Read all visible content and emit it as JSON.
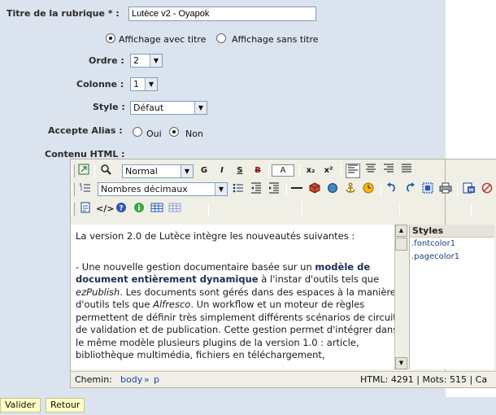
{
  "form": {
    "title_label": "Titre de la rubrique * :",
    "title_value": "Lutèce v2 - Oyapok",
    "display": {
      "with_title": "Affichage avec titre",
      "without_title": "Affichage sans titre",
      "selected": "with_title"
    },
    "order": {
      "label": "Ordre :",
      "value": "2"
    },
    "column": {
      "label": "Colonne :",
      "value": "1"
    },
    "style": {
      "label": "Style :",
      "value": "Défaut"
    },
    "alias": {
      "label": "Accepte Alias :",
      "yes": "Oui",
      "no": "Non",
      "selected": "no"
    },
    "html_label": "Contenu HTML :"
  },
  "editor": {
    "toolbar": {
      "format_value": "Normal",
      "list_style_value": "Nombres décimaux",
      "bold": "G",
      "italic": "I",
      "underline": "S",
      "strike": "B",
      "font_color": "A",
      "subscript": "x₂",
      "superscript": "x²"
    },
    "content": {
      "p1": "La version 2.0 de Lutèce intègre les nouveautés suivantes :",
      "p2_pre": "- Une nouvelle gestion documentaire basée sur un ",
      "p2_bold": "modèle de document entièrement dynamique",
      "p2_a": " à l'instar d'outils tels que ",
      "p2_em1": "ezPublish",
      "p2_b": ". Les documents sont gérés dans des espaces à la manière d'outils tels que ",
      "p2_em2": "Alfresco",
      "p2_c": ". Un workflow et un moteur de règles permettent de définir très simplement différents scénarios de circuits de validation et de publication. Cette gestion permet d'intégrer dans le même modèle plusieurs plugins de la version 1.0 : article, bibliothèque multimédia, fichiers en téléchargement,"
    },
    "styles_panel": {
      "header": "Styles",
      "items": [
        ".fontcolor1",
        ".pagecolor1"
      ]
    },
    "status": {
      "path_label": "Chemin:",
      "path_body": "body",
      "path_sep": "»",
      "path_p": "p",
      "stats": "HTML: 4291 | Mots: 515 | Ca"
    }
  },
  "buttons": {
    "submit": "Valider",
    "back": "Retour"
  }
}
